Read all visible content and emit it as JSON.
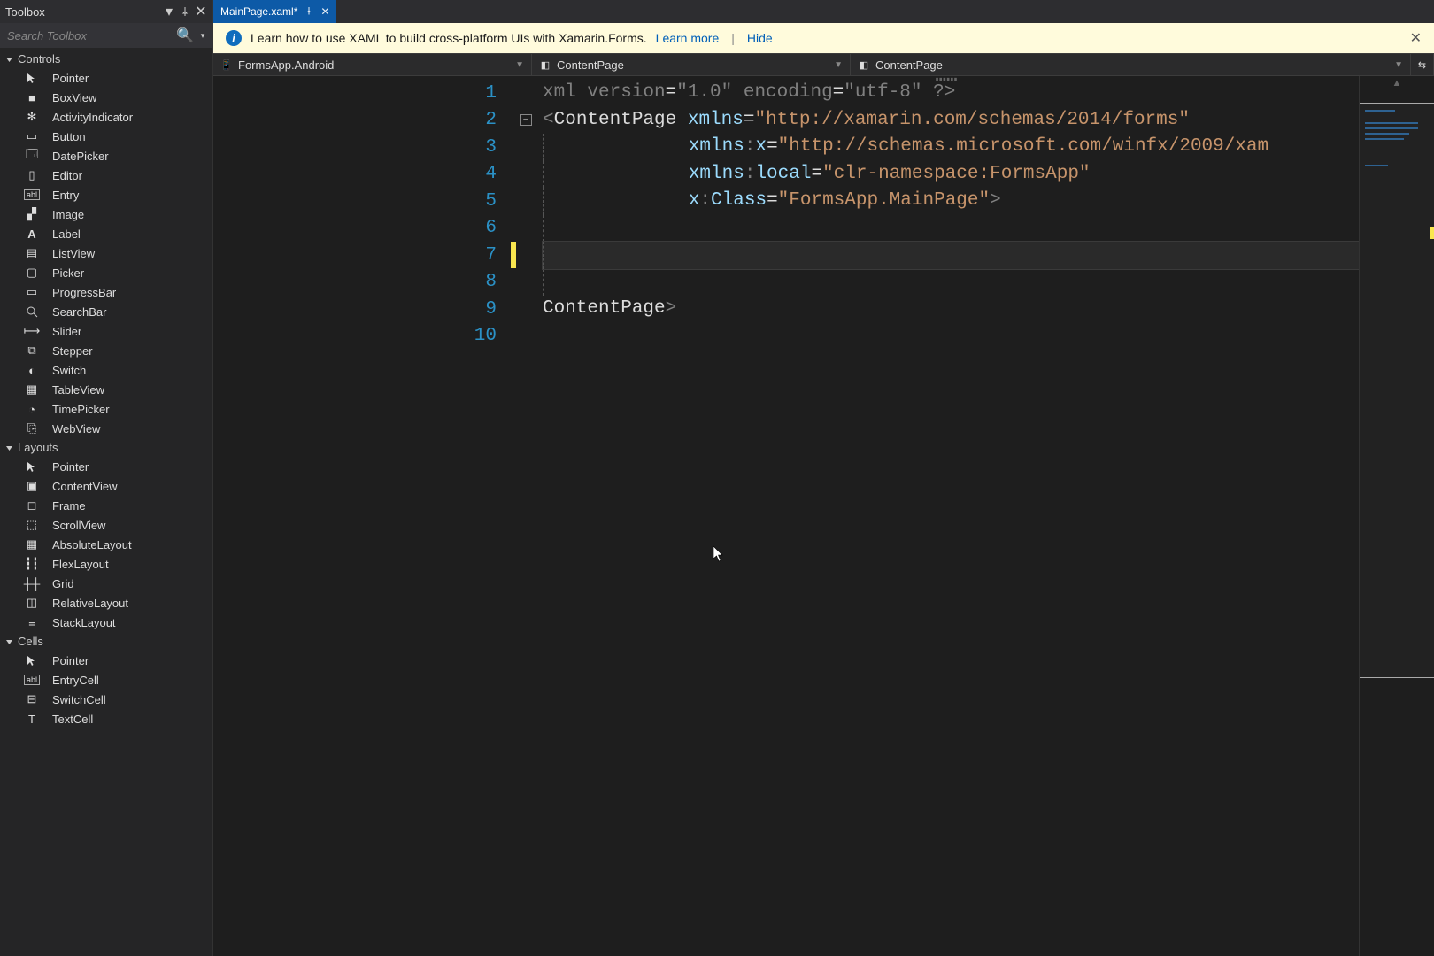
{
  "toolbox": {
    "title": "Toolbox",
    "search_placeholder": "Search Toolbox",
    "groups": [
      {
        "name": "Controls",
        "items": [
          {
            "label": "Pointer",
            "icon": "ptr"
          },
          {
            "label": "BoxView",
            "icon": "box"
          },
          {
            "label": "ActivityIndicator",
            "icon": "act"
          },
          {
            "label": "Button",
            "icon": "btn"
          },
          {
            "label": "DatePicker",
            "icon": "date"
          },
          {
            "label": "Editor",
            "icon": "edit"
          },
          {
            "label": "Entry",
            "icon": "entry"
          },
          {
            "label": "Image",
            "icon": "img"
          },
          {
            "label": "Label",
            "icon": "A"
          },
          {
            "label": "ListView",
            "icon": "list"
          },
          {
            "label": "Picker",
            "icon": "pick"
          },
          {
            "label": "ProgressBar",
            "icon": "prog"
          },
          {
            "label": "SearchBar",
            "icon": "search"
          },
          {
            "label": "Slider",
            "icon": "slide"
          },
          {
            "label": "Stepper",
            "icon": "step"
          },
          {
            "label": "Switch",
            "icon": "sw"
          },
          {
            "label": "TableView",
            "icon": "table"
          },
          {
            "label": "TimePicker",
            "icon": "time"
          },
          {
            "label": "WebView",
            "icon": "web"
          }
        ]
      },
      {
        "name": "Layouts",
        "items": [
          {
            "label": "Pointer",
            "icon": "ptr"
          },
          {
            "label": "ContentView",
            "icon": "cv"
          },
          {
            "label": "Frame",
            "icon": "frame"
          },
          {
            "label": "ScrollView",
            "icon": "scroll"
          },
          {
            "label": "AbsoluteLayout",
            "icon": "abs"
          },
          {
            "label": "FlexLayout",
            "icon": "flex"
          },
          {
            "label": "Grid",
            "icon": "grid"
          },
          {
            "label": "RelativeLayout",
            "icon": "rel"
          },
          {
            "label": "StackLayout",
            "icon": "stack"
          }
        ]
      },
      {
        "name": "Cells",
        "items": [
          {
            "label": "Pointer",
            "icon": "ptr"
          },
          {
            "label": "EntryCell",
            "icon": "ecell"
          },
          {
            "label": "SwitchCell",
            "icon": "scell"
          },
          {
            "label": "TextCell",
            "icon": "tcell"
          }
        ]
      }
    ]
  },
  "tab": {
    "title": "MainPage.xaml*"
  },
  "infobar": {
    "text": "Learn how to use XAML to build cross-platform UIs with Xamarin.Forms.",
    "learn": "Learn more",
    "hide": "Hide"
  },
  "context": {
    "project": "FormsApp.Android",
    "scope1": "ContentPage",
    "scope2": "ContentPage"
  },
  "editor": {
    "lines": [
      1,
      2,
      3,
      4,
      5,
      6,
      7,
      8,
      9,
      10
    ],
    "active_line": 7,
    "modified_lines": [
      7
    ],
    "fold_line": 2,
    "code": {
      "l1_a": "<?",
      "l1_b": "xml version",
      "l1_c": "=",
      "l1_d": "\"1.0\"",
      "l1_e": " encoding",
      "l1_f": "=",
      "l1_g": "\"utf-8\"",
      "l1_h": " ?>",
      "l2_a": "<",
      "l2_b": "ContentPage",
      "l2_c": " xmlns",
      "l2_d": "=",
      "l2_e": "\"http://xamarin.com/schemas/2014/forms\"",
      "l3_a": "xmlns",
      "l3_b": ":",
      "l3_c": "x",
      "l3_d": "=",
      "l3_e": "\"http://schemas.microsoft.com/winfx/2009/xam",
      "l4_a": "xmlns",
      "l4_b": ":",
      "l4_c": "local",
      "l4_d": "=",
      "l4_e": "\"clr-namespace:FormsApp\"",
      "l5_a": "x",
      "l5_b": ":",
      "l5_c": "Class",
      "l5_d": "=",
      "l5_e": "\"FormsApp.MainPage\"",
      "l5_f": ">",
      "l9_a": "</",
      "l9_b": "ContentPage",
      "l9_c": ">"
    }
  }
}
